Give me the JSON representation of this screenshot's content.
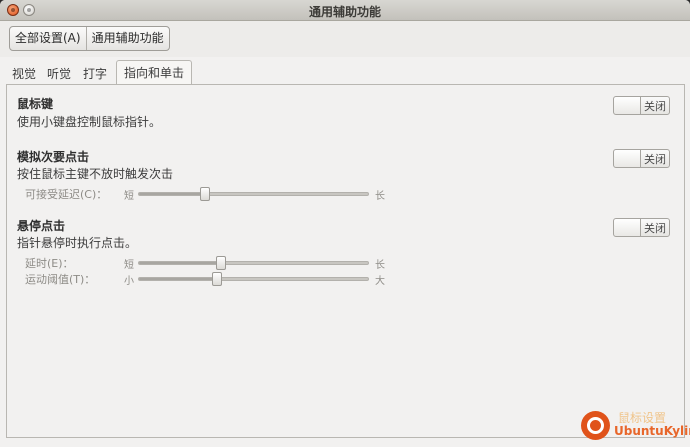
{
  "window": {
    "title": "通用辅助功能"
  },
  "toolbar": {
    "crumbs": [
      "全部设置(A)",
      "通用辅助功能"
    ]
  },
  "tabs": [
    {
      "label": "视觉",
      "active": false
    },
    {
      "label": "听觉",
      "active": false
    },
    {
      "label": "打字",
      "active": false
    },
    {
      "label": "指向和单击",
      "active": true
    }
  ],
  "sections": {
    "mouse_keys": {
      "title": "鼠标键",
      "description": "使用小键盘控制鼠标指针。",
      "toggle_label": "关闭"
    },
    "simulated_secondary_click": {
      "title": "模拟次要点击",
      "description": "按住鼠标主键不放时触发次击",
      "toggle_label": "关闭",
      "sliders": [
        {
          "label": "可接受延迟(C)：",
          "min_label": "短",
          "max_label": "长",
          "value": 0.29
        }
      ]
    },
    "hover_click": {
      "title": "悬停点击",
      "description": "指针悬停时执行点击。",
      "toggle_label": "关闭",
      "sliders": [
        {
          "label": "延时(E)：",
          "min_label": "短",
          "max_label": "长",
          "value": 0.36
        },
        {
          "label": "运动阈值(T)：",
          "min_label": "小",
          "max_label": "大",
          "value": 0.34
        }
      ]
    }
  },
  "watermark": {
    "caption": "鼠标设置",
    "brand": "UbuntuKylin"
  },
  "colors": {
    "ubuntu_orange": "#e0531a",
    "window_bg": "#f2f1f0"
  }
}
